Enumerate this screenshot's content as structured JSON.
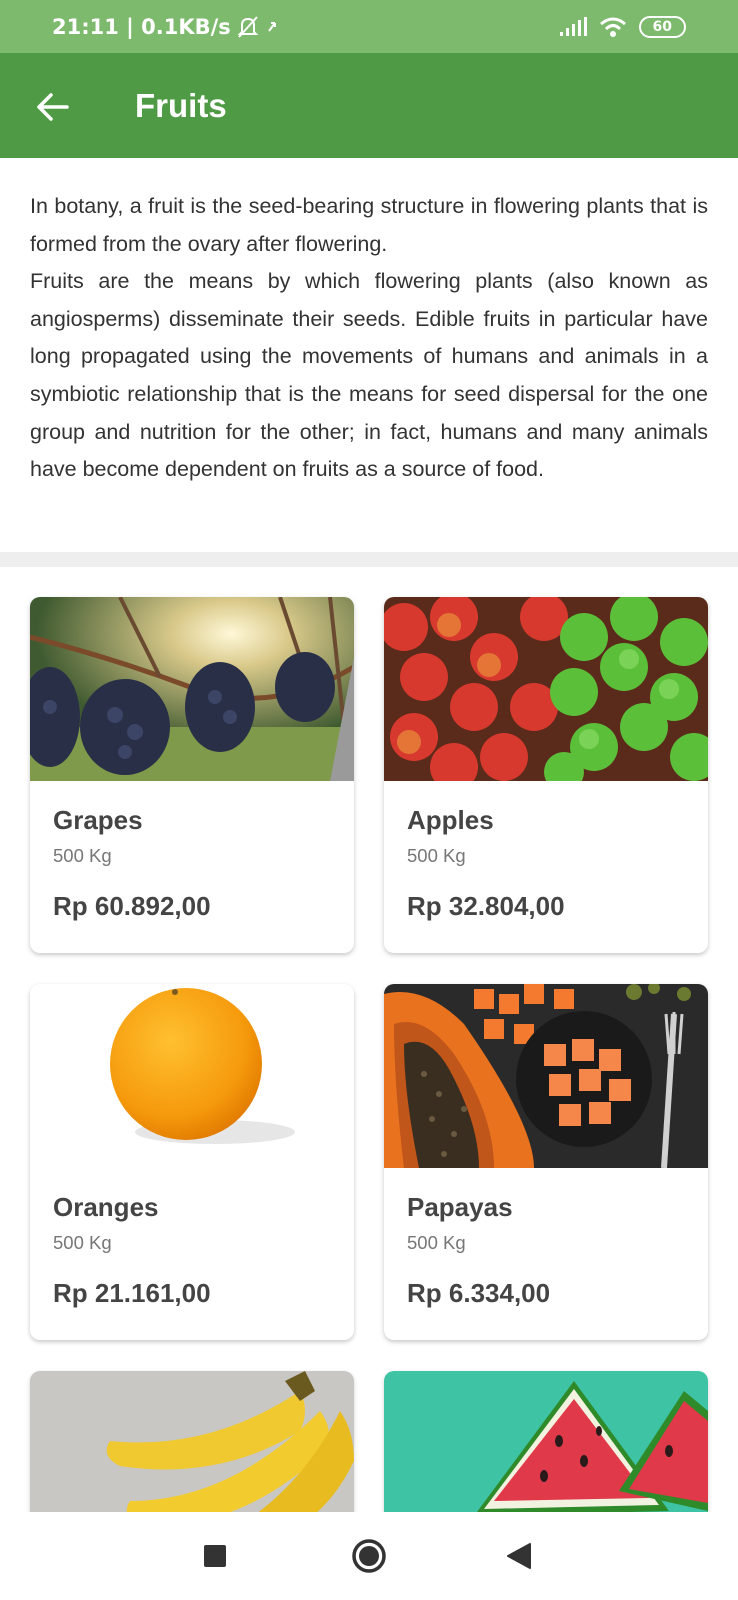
{
  "status_bar": {
    "time_speed": "21:11 | 0.1KB/s",
    "battery": "60"
  },
  "app_bar": {
    "title": "Fruits",
    "back_icon": "arrow-left-icon"
  },
  "description": {
    "paragraph_1": "In botany, a fruit is the seed-bearing structure in flowering plants that is formed from the ovary after flowering.",
    "paragraph_2": "Fruits are the means by which flowering plants (also known as angiosperms) disseminate their seeds. Edible fruits in particular have long propagated using the movements of humans and animals in a symbiotic relationship that is the means for seed dispersal for the one group and nutrition for the other; in fact, humans and many animals have become dependent on fruits as a source of food."
  },
  "products": [
    {
      "name": "Grapes",
      "weight": "500 Kg",
      "price": "Rp 60.892,00"
    },
    {
      "name": "Apples",
      "weight": "500 Kg",
      "price": "Rp 32.804,00"
    },
    {
      "name": "Oranges",
      "weight": "500 Kg",
      "price": "Rp 21.161,00"
    },
    {
      "name": "Papayas",
      "weight": "500 Kg",
      "price": "Rp 6.334,00"
    }
  ],
  "colors": {
    "status_bar": "#7dba6e",
    "app_bar": "#4f9a44",
    "divider": "#eeeeee"
  },
  "nav": {
    "recents_icon": "square-icon",
    "home_icon": "circle-icon",
    "back_icon": "triangle-back-icon"
  }
}
